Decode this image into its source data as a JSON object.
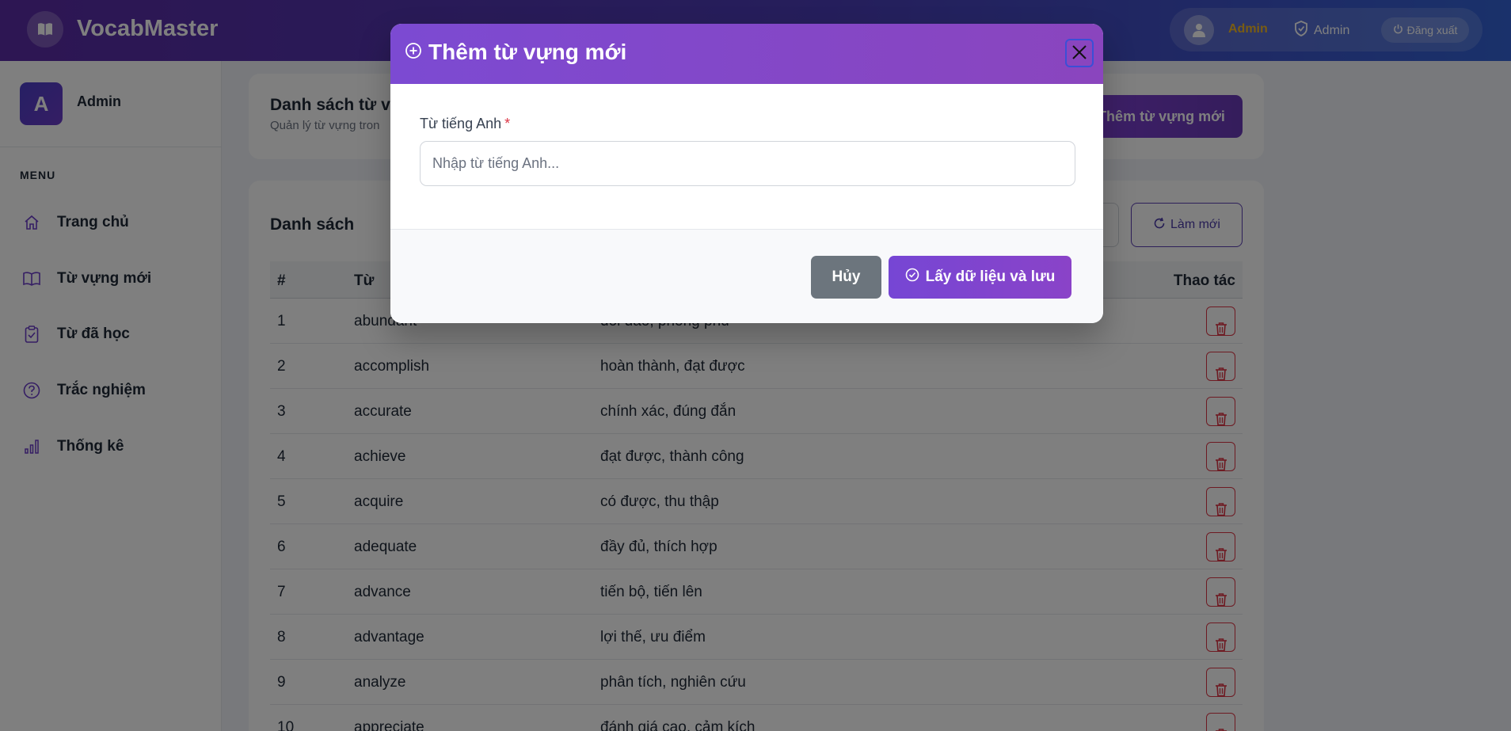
{
  "app": {
    "name": "VocabMaster"
  },
  "header": {
    "user_name": "Admin",
    "role": "Admin",
    "logout_label": "Đăng xuất"
  },
  "sidebar": {
    "avatar_letter": "A",
    "user_name": "Admin",
    "menu_label": "MENU",
    "items": [
      {
        "label": "Trang chủ",
        "icon": "home-icon"
      },
      {
        "label": "Từ vựng mới",
        "icon": "book-icon"
      },
      {
        "label": "Từ đã học",
        "icon": "checklist-icon"
      },
      {
        "label": "Trắc nghiệm",
        "icon": "question-icon"
      },
      {
        "label": "Thống kê",
        "icon": "bar-chart-icon"
      }
    ]
  },
  "page": {
    "title": "Danh sách từ vự",
    "subtitle": "Quản lý từ vựng tron",
    "add_button": "Thêm từ vựng mới"
  },
  "list": {
    "title": "Danh sách",
    "refresh_label": "Làm mới",
    "columns": {
      "num": "#",
      "word": "Từ",
      "action": "Thao tác"
    },
    "rows": [
      {
        "num": "1",
        "word": "abundant",
        "meaning": "dồi dào, phong phú"
      },
      {
        "num": "2",
        "word": "accomplish",
        "meaning": "hoàn thành, đạt được"
      },
      {
        "num": "3",
        "word": "accurate",
        "meaning": "chính xác, đúng đắn"
      },
      {
        "num": "4",
        "word": "achieve",
        "meaning": "đạt được, thành công"
      },
      {
        "num": "5",
        "word": "acquire",
        "meaning": "có được, thu thập"
      },
      {
        "num": "6",
        "word": "adequate",
        "meaning": "đầy đủ, thích hợp"
      },
      {
        "num": "7",
        "word": "advance",
        "meaning": "tiến bộ, tiến lên"
      },
      {
        "num": "8",
        "word": "advantage",
        "meaning": "lợi thế, ưu điểm"
      },
      {
        "num": "9",
        "word": "analyze",
        "meaning": "phân tích, nghiên cứu"
      },
      {
        "num": "10",
        "word": "appreciate",
        "meaning": "đánh giá cao, cảm kích"
      }
    ]
  },
  "modal": {
    "title": "Thêm từ vựng mới",
    "field_label": "Từ tiếng Anh",
    "required_mark": "*",
    "input_value": "",
    "input_placeholder": "Nhập từ tiếng Anh...",
    "cancel_label": "Hủy",
    "save_label": "Lấy dữ liệu và lưu"
  },
  "colors": {
    "accent": "#7b45d0",
    "header_start": "#5b2ca6",
    "header_end": "#3463d6",
    "danger": "#dc3545",
    "username_highlight": "#f2b925"
  }
}
